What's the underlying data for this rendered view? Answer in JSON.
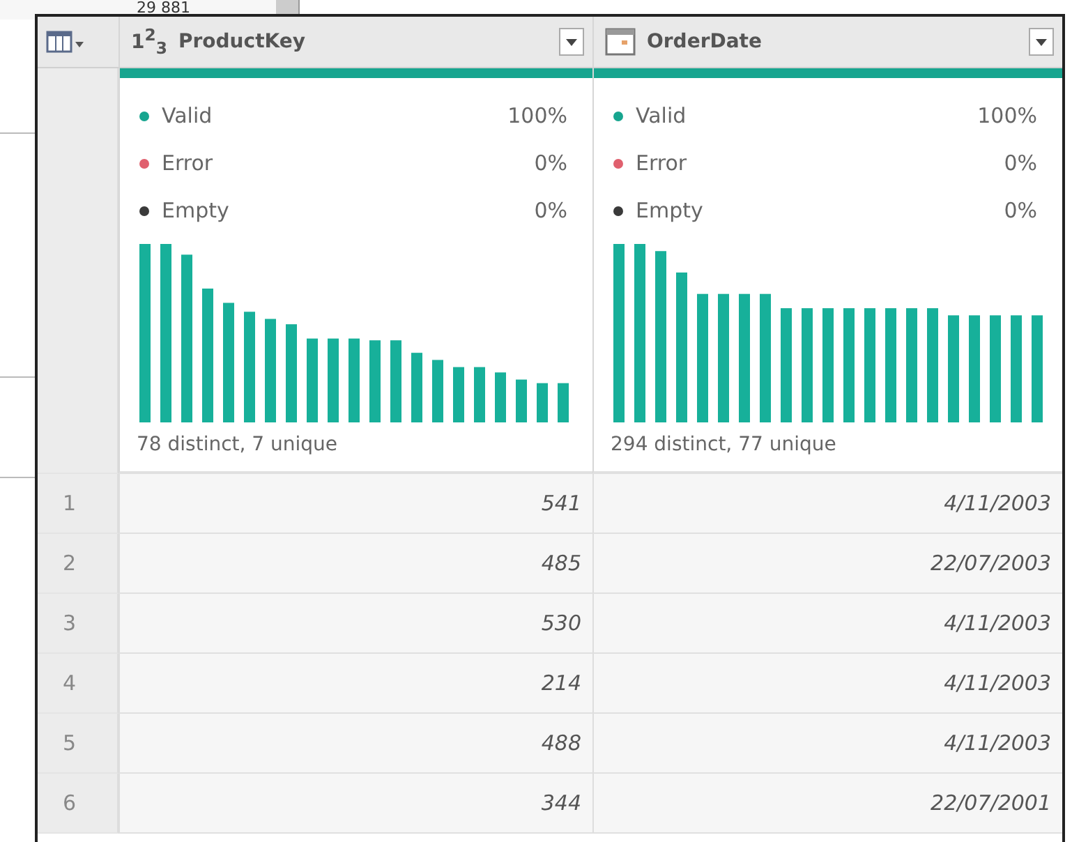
{
  "background": {
    "value": "29 881"
  },
  "table": {
    "columns": [
      {
        "kind": "number",
        "type_label": "1$^{2}$$_{3}$",
        "name": "ProductKey",
        "quality": [
          {
            "label": "Valid",
            "percent": "100%",
            "color": "#17a58f"
          },
          {
            "label": "Error",
            "percent": "0%",
            "color": "#e0606e"
          },
          {
            "label": "Empty",
            "percent": "0%",
            "color": "#3a3a3a"
          }
        ],
        "distribution": "78 distinct, 7 unique"
      },
      {
        "kind": "date",
        "name": "OrderDate",
        "quality": [
          {
            "label": "Valid",
            "percent": "100%",
            "color": "#17a58f"
          },
          {
            "label": "Error",
            "percent": "0%",
            "color": "#e0606e"
          },
          {
            "label": "Empty",
            "percent": "0%",
            "color": "#3a3a3a"
          }
        ],
        "distribution": "294 distinct, 77 unique"
      }
    ],
    "rows": [
      {
        "index": "1",
        "cells": [
          "541",
          "4/11/2003"
        ]
      },
      {
        "index": "2",
        "cells": [
          "485",
          "22/07/2003"
        ]
      },
      {
        "index": "3",
        "cells": [
          "530",
          "4/11/2003"
        ]
      },
      {
        "index": "4",
        "cells": [
          "214",
          "4/11/2003"
        ]
      },
      {
        "index": "5",
        "cells": [
          "488",
          "4/11/2003"
        ]
      },
      {
        "index": "6",
        "cells": [
          "344",
          "22/07/2001"
        ]
      }
    ]
  }
}
